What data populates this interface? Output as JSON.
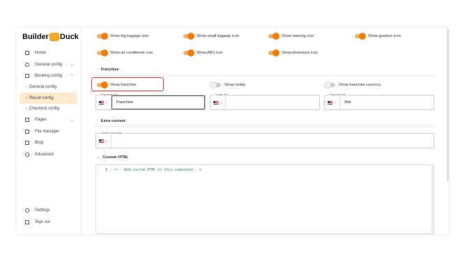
{
  "brand": {
    "name_left": "Builder",
    "name_right": "Duck"
  },
  "sidebar": {
    "items": [
      {
        "label": "Home",
        "icon": "home-icon"
      },
      {
        "label": "General config",
        "icon": "gear-icon",
        "chevron": "⌄"
      },
      {
        "label": "Booking config",
        "icon": "calendar-icon",
        "chevron": "⌃"
      }
    ],
    "subitems": [
      {
        "label": "General config"
      },
      {
        "label": "Result config"
      },
      {
        "label": "Checkout config"
      }
    ],
    "items2": [
      {
        "label": "Pages",
        "icon": "pages-icon",
        "chevron": "⌄"
      },
      {
        "label": "File manager",
        "icon": "image-icon"
      },
      {
        "label": "Blog",
        "icon": "document-icon"
      },
      {
        "label": "Advanced",
        "icon": "wrench-icon"
      }
    ],
    "bottom": [
      {
        "label": "Settings",
        "icon": "gear-icon"
      },
      {
        "label": "Sign out",
        "icon": "sign-out-icon"
      }
    ]
  },
  "switches_top": [
    {
      "label": "Show big luggage icon",
      "on": true
    },
    {
      "label": "Show small luggage icon",
      "on": true
    },
    {
      "label": "Show steering icon",
      "on": true
    },
    {
      "label": "Show gearbox icon",
      "on": true
    },
    {
      "label": "Show air conditioner icon",
      "on": true
    },
    {
      "label": "Show ABS icon",
      "on": true
    },
    {
      "label": "Show kilometers icon",
      "on": true
    }
  ],
  "franchise": {
    "title": "Franchise",
    "switches": [
      {
        "label": "Show franchise",
        "on": true
      },
      {
        "label": "Show tooltip",
        "on": false
      },
      {
        "label": "Show franchise currency",
        "on": false
      }
    ],
    "fields": [
      {
        "label": "Franchise text",
        "value": "Franchise"
      },
      {
        "label": "Tooltip text",
        "value": ""
      },
      {
        "label": "Franchise link",
        "value": "/link"
      }
    ]
  },
  "extra": {
    "title": "Extra content",
    "field_label": "Custom message",
    "field_value": ""
  },
  "custom_html": {
    "title": "Custom HTML",
    "line_number": "1",
    "code": "<!-- Add custom HTML to this component -->"
  },
  "colors": {
    "accent": "#f57c00",
    "highlight": "#e53935",
    "active_bg": "#fdeacc"
  }
}
